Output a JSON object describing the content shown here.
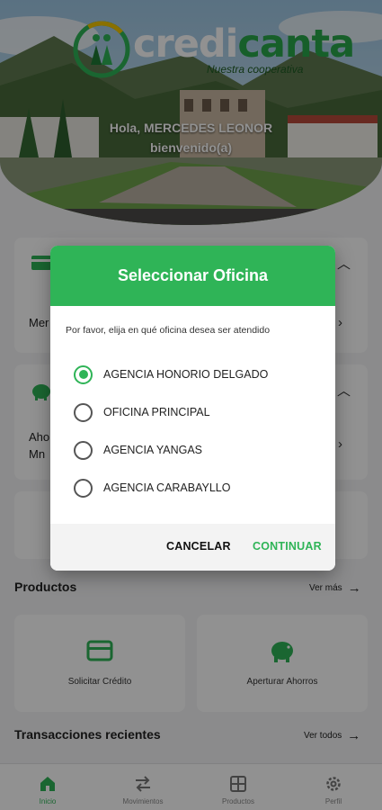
{
  "header": {
    "brand_part1": "credi",
    "brand_part2": "canta",
    "tagline": "Nuestra cooperativa",
    "greeting_line1": "Hola, MERCEDES LEONOR",
    "greeting_line2": "bienvenido(a)"
  },
  "accounts": {
    "row1_text": "Mer",
    "row2_line1": "Aho",
    "row2_line2": "Mn"
  },
  "products": {
    "title": "Productos",
    "see_more": "Ver más",
    "items": [
      {
        "label": "Solicitar Crédito",
        "icon": "credit-card-icon"
      },
      {
        "label": "Aperturar Ahorros",
        "icon": "piggy-bank-icon"
      }
    ]
  },
  "transactions": {
    "title": "Transacciones recientes",
    "see_all": "Ver todos"
  },
  "nav": {
    "items": [
      {
        "label": "Inicio",
        "icon": "home-icon",
        "active": true
      },
      {
        "label": "Movimientos",
        "icon": "transfer-icon",
        "active": false
      },
      {
        "label": "Productos",
        "icon": "grid-icon",
        "active": false
      },
      {
        "label": "Perfil",
        "icon": "gear-icon",
        "active": false
      }
    ]
  },
  "dialog": {
    "title": "Seleccionar Oficina",
    "message": "Por favor, elija en qué oficina desea ser atendido",
    "options": [
      {
        "label": "AGENCIA HONORIO DELGADO",
        "selected": true
      },
      {
        "label": "OFICINA PRINCIPAL",
        "selected": false
      },
      {
        "label": "AGENCIA YANGAS",
        "selected": false
      },
      {
        "label": "AGENCIA CARABAYLLO",
        "selected": false
      }
    ],
    "cancel_label": "CANCELAR",
    "continue_label": "CONTINUAR"
  },
  "colors": {
    "primary_green": "#2fb457",
    "overlay": "rgba(0,0,0,0.43)"
  }
}
